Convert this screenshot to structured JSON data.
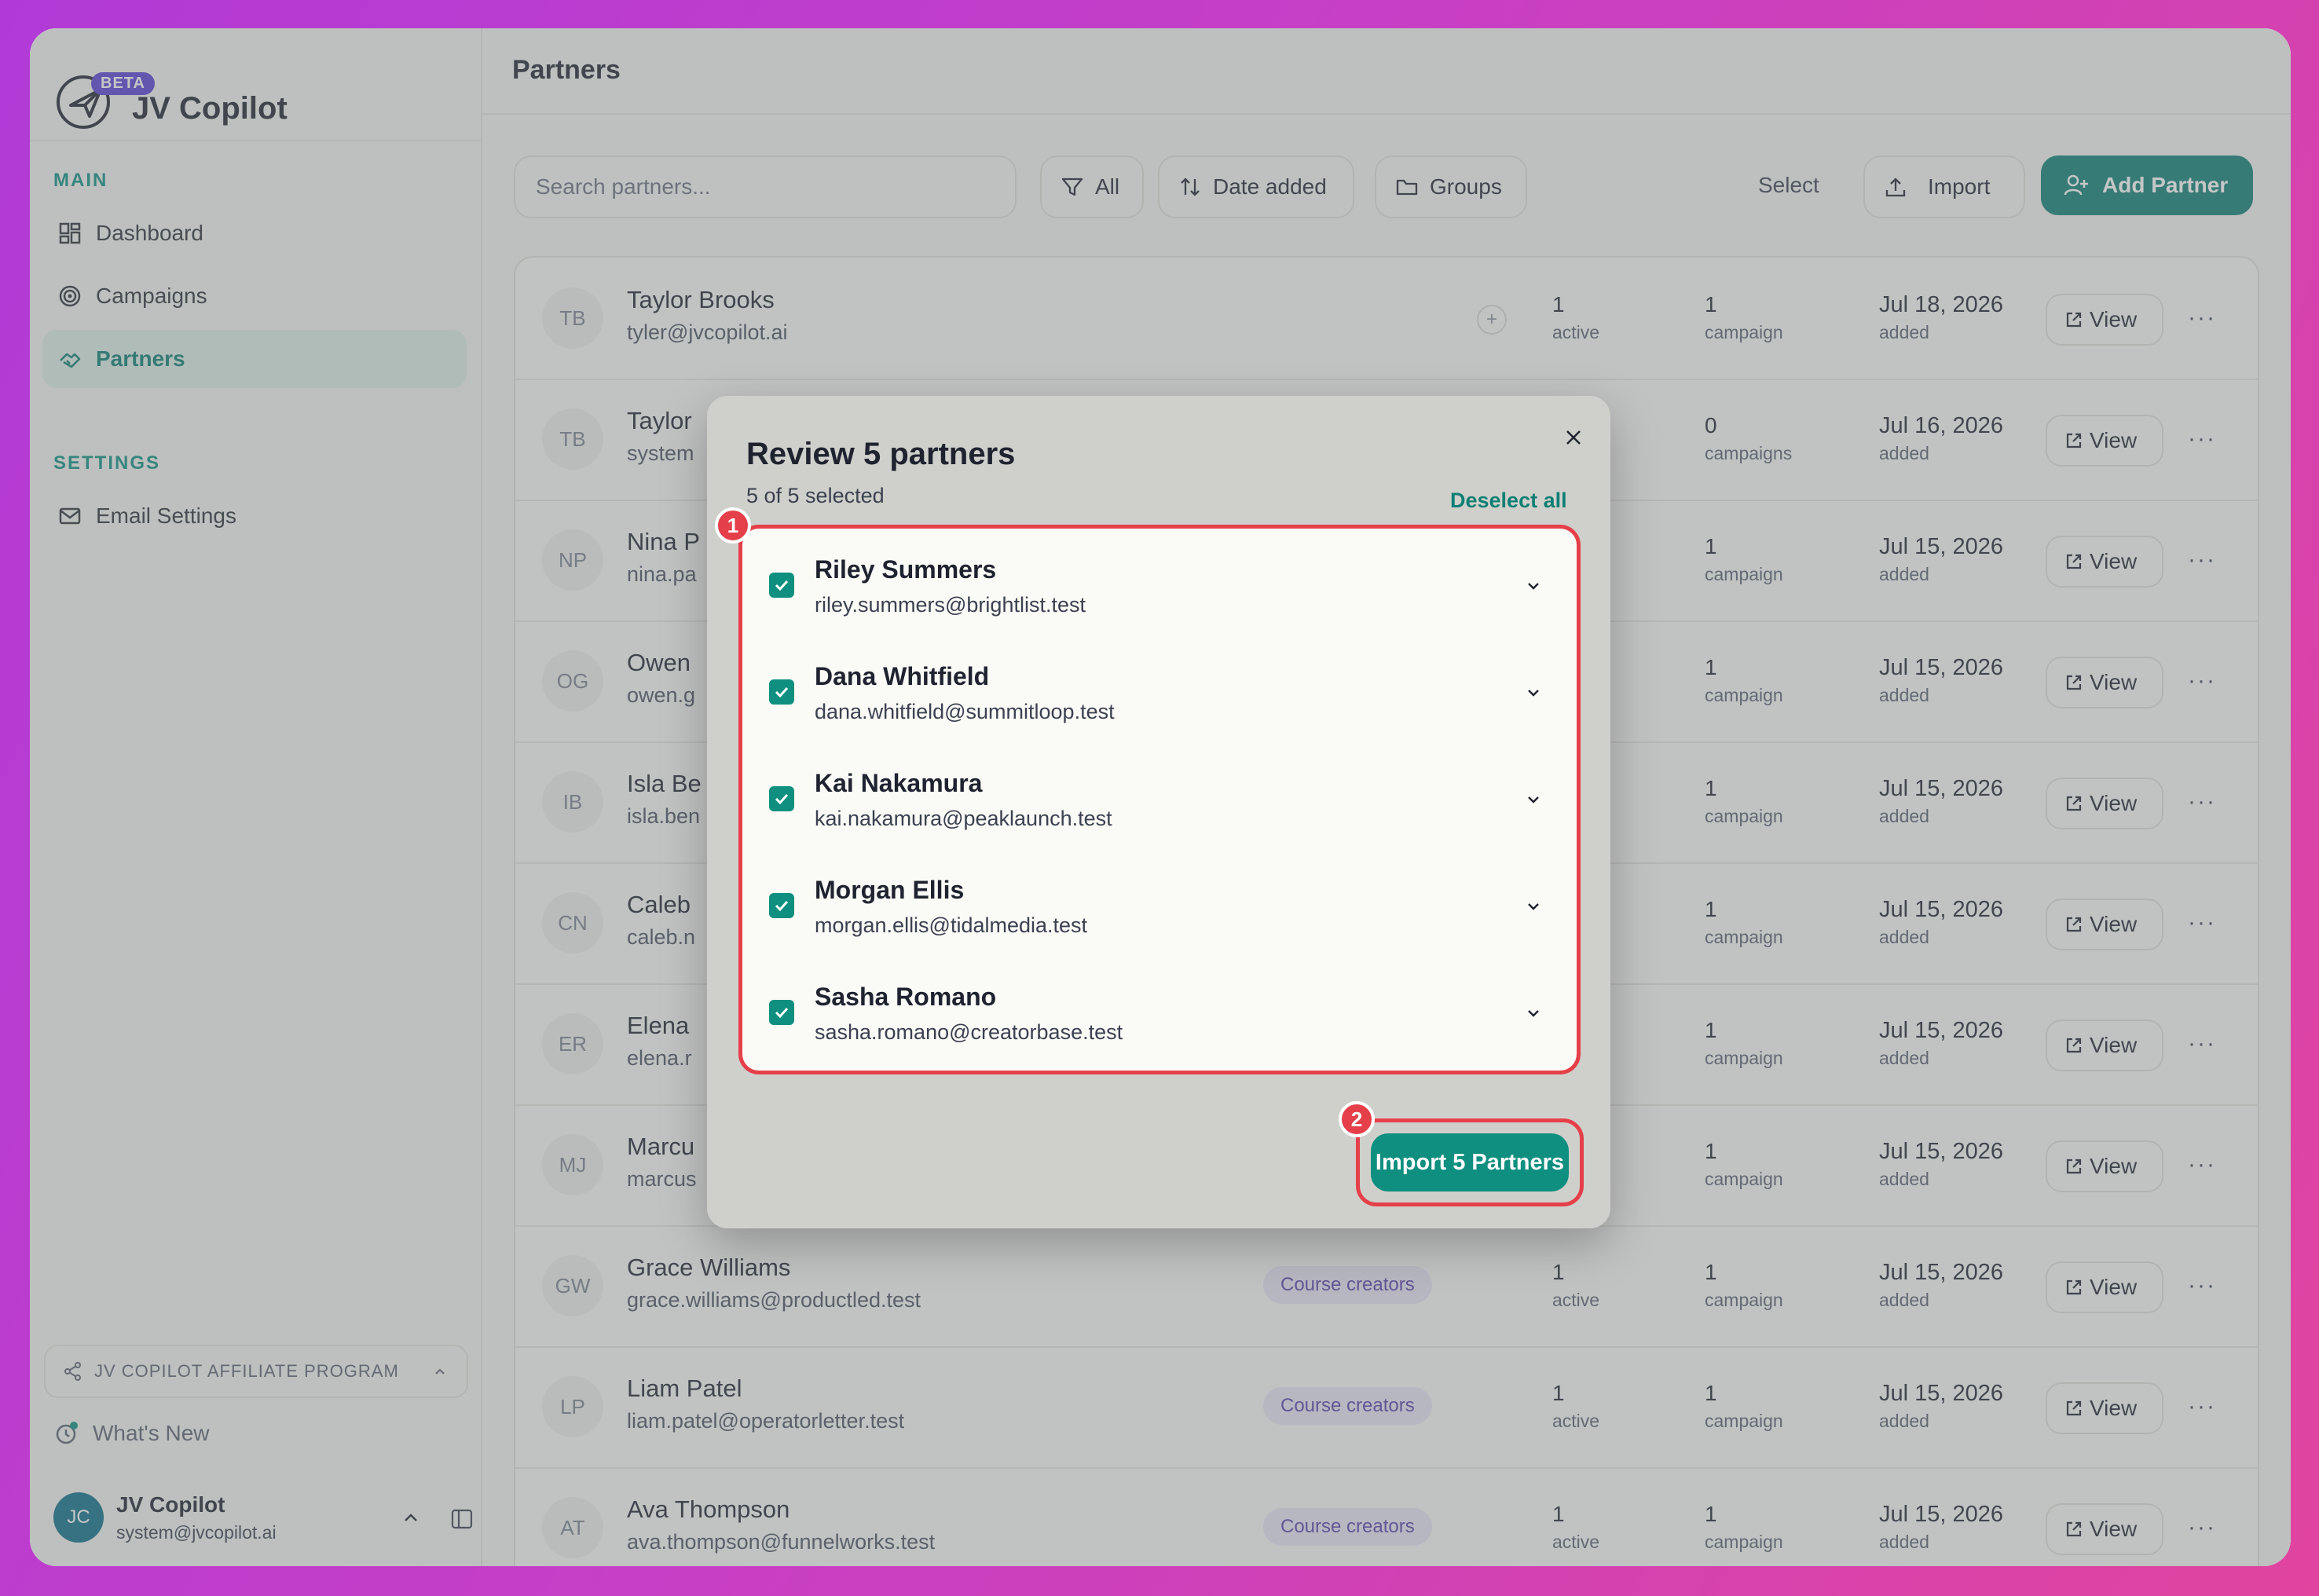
{
  "app": {
    "name": "JV Copilot",
    "beta_label": "BETA"
  },
  "sidebar": {
    "main_label": "MAIN",
    "settings_label": "SETTINGS",
    "items": [
      {
        "label": "Dashboard",
        "icon": "grid-icon"
      },
      {
        "label": "Campaigns",
        "icon": "target-icon"
      },
      {
        "label": "Partners",
        "icon": "handshake-icon",
        "active": true
      },
      {
        "label": "Email Settings",
        "icon": "mail-icon"
      }
    ],
    "affiliate_label": "JV COPILOT AFFILIATE PROGRAM",
    "whats_new": "What's New",
    "user": {
      "initials": "JC",
      "name": "JV Copilot",
      "email": "system@jvcopilot.ai"
    }
  },
  "header": {
    "title": "Partners"
  },
  "toolbar": {
    "search_placeholder": "Search partners...",
    "filter_label": "All",
    "sort_label": "Date added",
    "groups_label": "Groups",
    "select_label": "Select",
    "import_label": "Import",
    "add_label": "Add Partner"
  },
  "table": {
    "view_label": "View",
    "rows": [
      {
        "initials": "TB",
        "name": "Taylor Brooks",
        "email": "tyler@jvcopilot.ai",
        "tag": "",
        "active_count": "1",
        "active_label": "active",
        "campaign_count": "1",
        "campaign_label": "campaign",
        "date": "Jul 18, 2026",
        "date_label": "added"
      },
      {
        "initials": "TB",
        "name": "Taylor",
        "email": "system",
        "tag": "",
        "active_count": "",
        "active_label": "",
        "campaign_count": "0",
        "campaign_label": "campaigns",
        "date": "Jul 16, 2026",
        "date_label": "added"
      },
      {
        "initials": "NP",
        "name": "Nina P",
        "email": "nina.pa",
        "tag": "",
        "active_count": "",
        "active_label": "",
        "campaign_count": "1",
        "campaign_label": "campaign",
        "date": "Jul 15, 2026",
        "date_label": "added"
      },
      {
        "initials": "OG",
        "name": "Owen",
        "email": "owen.g",
        "tag": "",
        "active_count": "",
        "active_label": "",
        "campaign_count": "1",
        "campaign_label": "campaign",
        "date": "Jul 15, 2026",
        "date_label": "added"
      },
      {
        "initials": "IB",
        "name": "Isla Be",
        "email": "isla.ben",
        "tag": "",
        "active_count": "",
        "active_label": "",
        "campaign_count": "1",
        "campaign_label": "campaign",
        "date": "Jul 15, 2026",
        "date_label": "added"
      },
      {
        "initials": "CN",
        "name": "Caleb",
        "email": "caleb.n",
        "tag": "",
        "active_count": "",
        "active_label": "",
        "campaign_count": "1",
        "campaign_label": "campaign",
        "date": "Jul 15, 2026",
        "date_label": "added"
      },
      {
        "initials": "ER",
        "name": "Elena",
        "email": "elena.r",
        "tag": "",
        "active_count": "",
        "active_label": "",
        "campaign_count": "1",
        "campaign_label": "campaign",
        "date": "Jul 15, 2026",
        "date_label": "added"
      },
      {
        "initials": "MJ",
        "name": "Marcu",
        "email": "marcus",
        "tag": "",
        "active_count": "",
        "active_label": "",
        "campaign_count": "1",
        "campaign_label": "campaign",
        "date": "Jul 15, 2026",
        "date_label": "added"
      },
      {
        "initials": "GW",
        "name": "Grace Williams",
        "email": "grace.williams@productled.test",
        "tag": "Course creators",
        "active_count": "1",
        "active_label": "active",
        "campaign_count": "1",
        "campaign_label": "campaign",
        "date": "Jul 15, 2026",
        "date_label": "added"
      },
      {
        "initials": "LP",
        "name": "Liam Patel",
        "email": "liam.patel@operatorletter.test",
        "tag": "Course creators",
        "active_count": "1",
        "active_label": "active",
        "campaign_count": "1",
        "campaign_label": "campaign",
        "date": "Jul 15, 2026",
        "date_label": "added"
      },
      {
        "initials": "AT",
        "name": "Ava Thompson",
        "email": "ava.thompson@funnelworks.test",
        "tag": "Course creators",
        "active_count": "1",
        "active_label": "active",
        "campaign_count": "1",
        "campaign_label": "campaign",
        "date": "Jul 15, 2026",
        "date_label": "added"
      }
    ]
  },
  "modal": {
    "title": "Review 5 partners",
    "subtitle": "5 of 5 selected",
    "deselect_label": "Deselect all",
    "partners": [
      {
        "name": "Riley Summers",
        "email": "riley.summers@brightlist.test",
        "checked": true
      },
      {
        "name": "Dana Whitfield",
        "email": "dana.whitfield@summitloop.test",
        "checked": true
      },
      {
        "name": "Kai Nakamura",
        "email": "kai.nakamura@peaklaunch.test",
        "checked": true
      },
      {
        "name": "Morgan Ellis",
        "email": "morgan.ellis@tidalmedia.test",
        "checked": true
      },
      {
        "name": "Sasha Romano",
        "email": "sasha.romano@creatorbase.test",
        "checked": true
      }
    ],
    "import_label": "Import 5 Partners",
    "annotation_1": "1",
    "annotation_2": "2"
  },
  "colors": {
    "accent": "#0f7f74",
    "annotation": "#e5404a",
    "tag_bg": "#ebe5f7"
  }
}
